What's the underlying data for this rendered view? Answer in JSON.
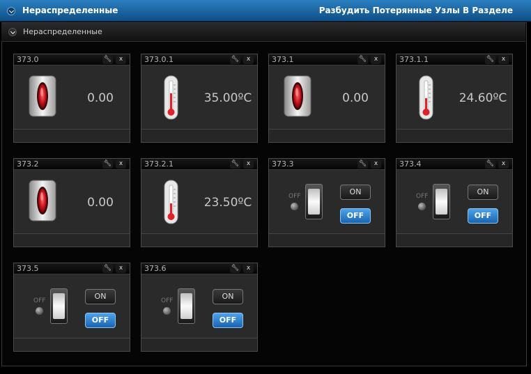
{
  "header": {
    "title": "Нераспределенные",
    "action": "Разбудить Потерянные Узлы В Разделе"
  },
  "section": {
    "title": "Нераспределенные"
  },
  "tiles": [
    {
      "id": "373.0",
      "kind": "meter",
      "value": "0.00"
    },
    {
      "id": "373.0.1",
      "kind": "thermometer",
      "value": "35.00ºC"
    },
    {
      "id": "373.1",
      "kind": "meter",
      "value": "0.00"
    },
    {
      "id": "373.1.1",
      "kind": "thermometer",
      "value": "24.60ºC"
    },
    {
      "id": "373.2",
      "kind": "meter",
      "value": "0.00"
    },
    {
      "id": "373.2.1",
      "kind": "thermometer",
      "value": "23.50ºC"
    },
    {
      "id": "373.3",
      "kind": "switch",
      "state_label": "OFF",
      "on_label": "ON",
      "off_label": "OFF"
    },
    {
      "id": "373.4",
      "kind": "switch",
      "state_label": "OFF",
      "on_label": "ON",
      "off_label": "OFF"
    },
    {
      "id": "373.5",
      "kind": "switch",
      "state_label": "OFF",
      "on_label": "ON",
      "off_label": "OFF"
    },
    {
      "id": "373.6",
      "kind": "switch",
      "state_label": "OFF",
      "on_label": "ON",
      "off_label": "OFF"
    }
  ],
  "tile_buttons": {
    "settings_icon": "wrench-icon",
    "close_label": "x"
  },
  "colors": {
    "header_blue": "#1a67a8",
    "off_button": "#2f86d4",
    "meter_red": "#d0101a",
    "thermo_red": "#e0202a"
  }
}
